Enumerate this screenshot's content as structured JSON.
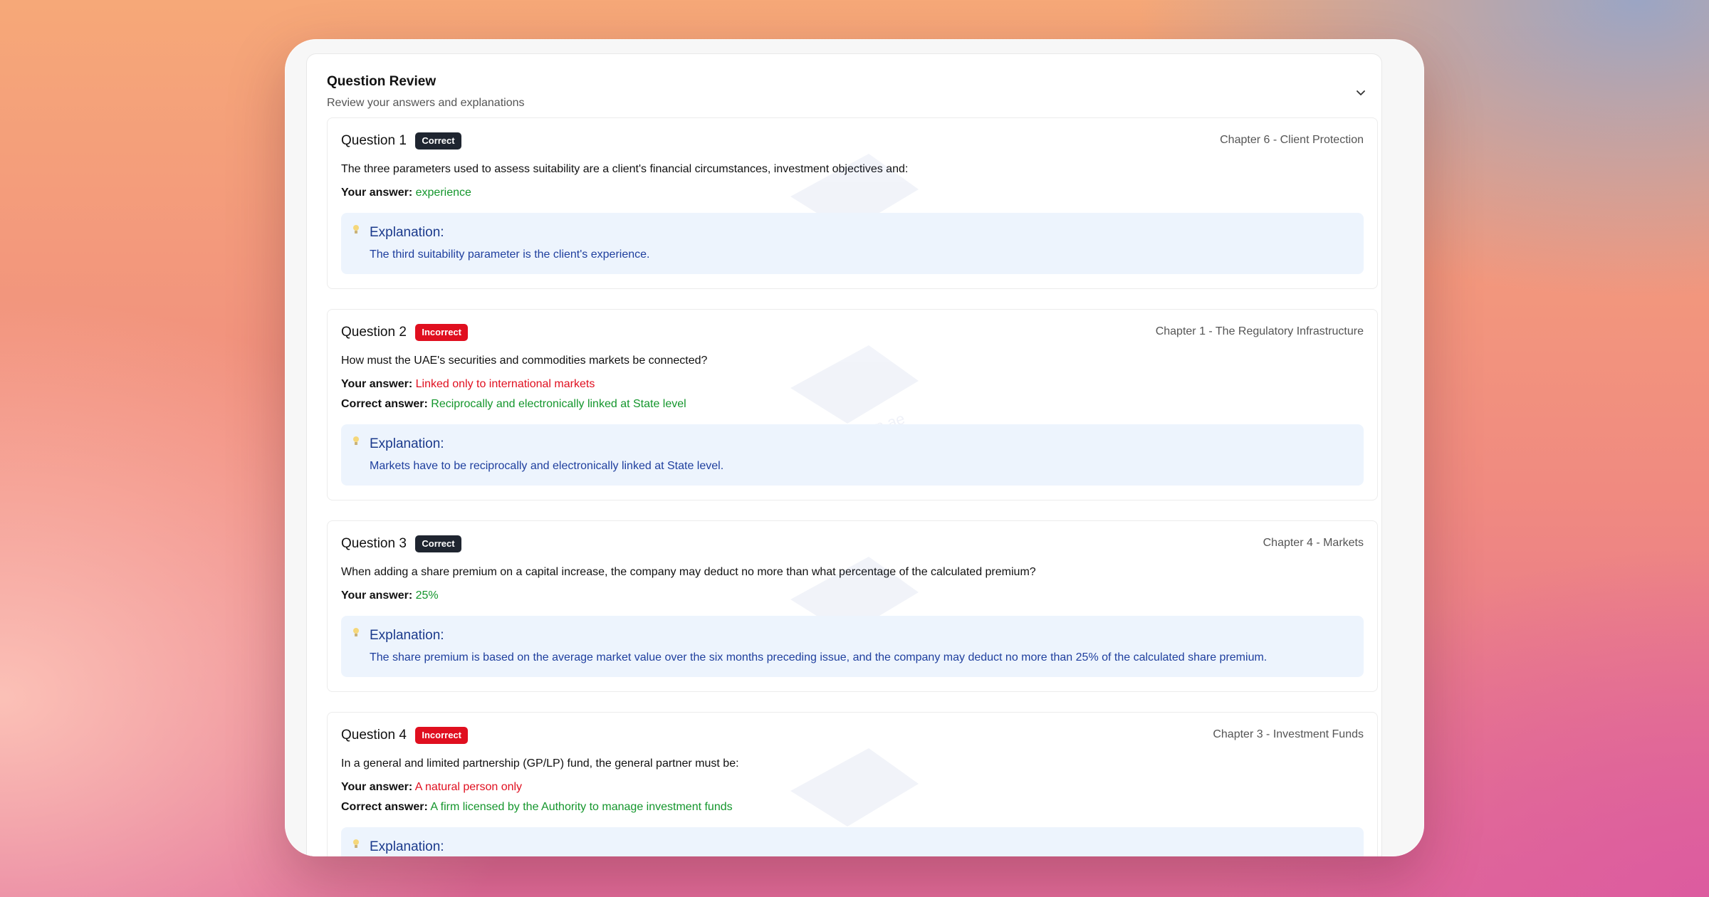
{
  "panel": {
    "title": "Question Review",
    "subtitle": "Review your answers and explanations"
  },
  "watermark": "ExamPrep.ae",
  "questions": [
    {
      "label": "Question 1",
      "status": "Correct",
      "chapter": "Chapter 6 - Client Protection",
      "text": "The three parameters used to assess suitability are a client's financial circumstances, investment objectives and:",
      "your_answer_label": "Your answer:",
      "your_answer": "experience",
      "explanation_title": "Explanation:",
      "explanation": "The third suitability parameter is the client's experience."
    },
    {
      "label": "Question 2",
      "status": "Incorrect",
      "chapter": "Chapter 1 - The Regulatory Infrastructure",
      "text": "How must the UAE's securities and commodities markets be connected?",
      "your_answer_label": "Your answer:",
      "your_answer": "Linked only to international markets",
      "correct_answer_label": "Correct answer:",
      "correct_answer": "Reciprocally and electronically linked at State level",
      "explanation_title": "Explanation:",
      "explanation": "Markets have to be reciprocally and electronically linked at State level."
    },
    {
      "label": "Question 3",
      "status": "Correct",
      "chapter": "Chapter 4 - Markets",
      "text": "When adding a share premium on a capital increase, the company may deduct no more than what percentage of the calculated premium?",
      "your_answer_label": "Your answer:",
      "your_answer": "25%",
      "explanation_title": "Explanation:",
      "explanation": "The share premium is based on the average market value over the six months preceding issue, and the company may deduct no more than 25% of the calculated share premium."
    },
    {
      "label": "Question 4",
      "status": "Incorrect",
      "chapter": "Chapter 3 - Investment Funds",
      "text": "In a general and limited partnership (GP/LP) fund, the general partner must be:",
      "your_answer_label": "Your answer:",
      "your_answer": "A natural person only",
      "correct_answer_label": "Correct answer:",
      "correct_answer": "A firm licensed by the Authority to manage investment funds",
      "explanation_title": "Explanation:"
    }
  ],
  "colors": {
    "correct_badge": "#1f2530",
    "incorrect_badge": "#e00f1f",
    "correct_text": "#14962c",
    "incorrect_text": "#e00f1f",
    "explanation_bg": "#edf4fd",
    "explanation_text": "#1f3f9e"
  },
  "icons": {
    "collapse": "chevron-down-icon",
    "explanation": "lightbulb-icon"
  }
}
